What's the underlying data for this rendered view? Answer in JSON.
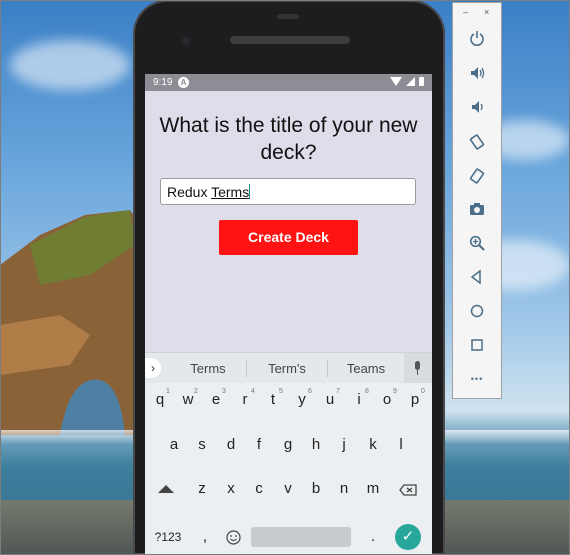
{
  "status_bar": {
    "time": "9:19",
    "notification_badge": "A"
  },
  "app": {
    "title": "What is the title of your new deck?",
    "input_value_plain": "Redux ",
    "input_value_underlined": "Terms",
    "create_button_label": "Create Deck",
    "button_color": "#ff1212"
  },
  "keyboard": {
    "expand_arrow": "›",
    "suggestions": [
      "Terms",
      "Term's",
      "Teams"
    ],
    "row1": [
      {
        "key": "q",
        "hint": "1"
      },
      {
        "key": "w",
        "hint": "2"
      },
      {
        "key": "e",
        "hint": "3"
      },
      {
        "key": "r",
        "hint": "4"
      },
      {
        "key": "t",
        "hint": "5"
      },
      {
        "key": "y",
        "hint": "6"
      },
      {
        "key": "u",
        "hint": "7"
      },
      {
        "key": "i",
        "hint": "8"
      },
      {
        "key": "o",
        "hint": "9"
      },
      {
        "key": "p",
        "hint": "0"
      }
    ],
    "row2": [
      "a",
      "s",
      "d",
      "f",
      "g",
      "h",
      "j",
      "k",
      "l"
    ],
    "row3": [
      "z",
      "x",
      "c",
      "v",
      "b",
      "n",
      "m"
    ],
    "symbols_label": "?123",
    "comma": ",",
    "period": ".",
    "enter_icon": "checkmark-icon",
    "accent_color": "#27a79a"
  },
  "emulator_panel": {
    "minimize": "–",
    "close": "×",
    "tools": [
      "power-icon",
      "volume-up-icon",
      "volume-down-icon",
      "rotate-left-icon",
      "rotate-right-icon",
      "camera-icon",
      "zoom-icon",
      "back-icon",
      "home-icon",
      "overview-icon",
      "more-icon"
    ],
    "more_label": "•••"
  }
}
